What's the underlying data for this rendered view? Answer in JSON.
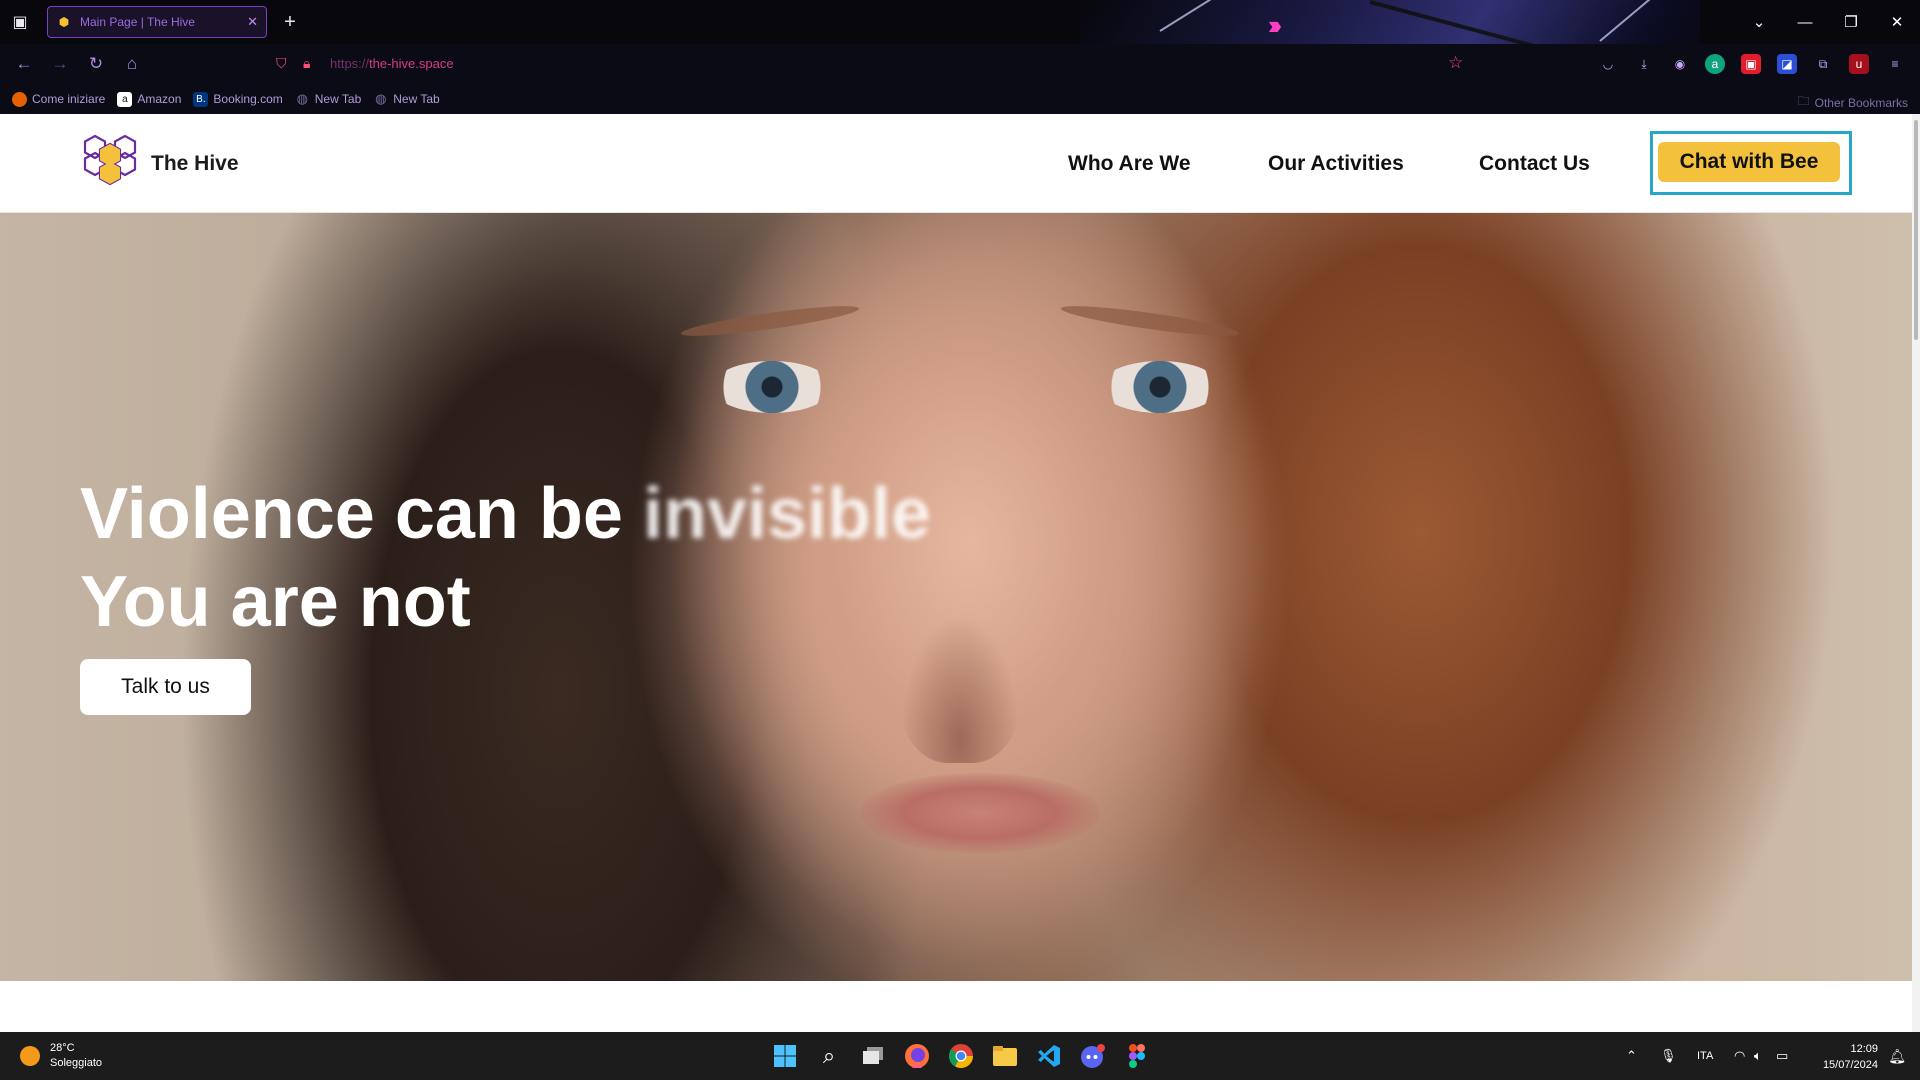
{
  "browser": {
    "tab_title": "Main Page | The Hive",
    "url_scheme": "https://",
    "url_host": "the-hive.space",
    "bookmarks": [
      {
        "label": "Come iniziare",
        "icon": "firefox-icon",
        "color": "#e66000"
      },
      {
        "label": "Amazon",
        "icon": "amazon-icon",
        "color": "#ffffff"
      },
      {
        "label": "Booking.com",
        "icon": "booking-icon",
        "color": "#003580"
      },
      {
        "label": "New Tab",
        "icon": "globe-icon",
        "color": "#7c6ea4"
      },
      {
        "label": "New Tab",
        "icon": "globe-icon",
        "color": "#7c6ea4"
      }
    ],
    "other_bookmarks": "Other Bookmarks"
  },
  "site": {
    "brand": "The Hive",
    "nav": {
      "who": "Who Are We",
      "activities": "Our Activities",
      "contact": "Contact Us"
    },
    "cta": "Chat with Bee",
    "accent": "#f3c13b",
    "logo_purple": "#6a2aa0"
  },
  "hero": {
    "line1": "Violence can be",
    "line1_blur": "invisible",
    "line2": "You are not",
    "button": "Talk to us"
  },
  "taskbar": {
    "temperature": "28°C",
    "condition": "Soleggiato",
    "language": "ITA",
    "time": "12:09",
    "date": "15/07/2024"
  }
}
